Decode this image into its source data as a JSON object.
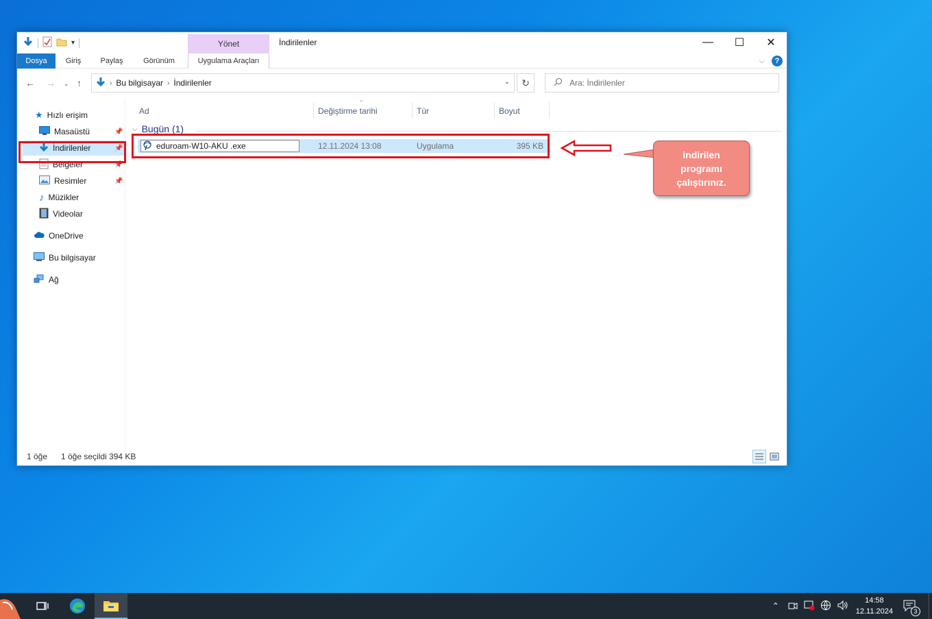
{
  "window": {
    "title": "İndirilenler",
    "context_group": "Yönet",
    "tabs": [
      "Dosya",
      "Giriş",
      "Paylaş",
      "Görünüm",
      "Uygulama Araçları"
    ]
  },
  "address": {
    "crumbs": [
      "Bu bilgisayar",
      "İndirilenler"
    ],
    "search_placeholder": "Ara: İndirilenler"
  },
  "nav": {
    "quick_access": "Hızlı erişim",
    "items": [
      "Masaüstü",
      "İndirilenler",
      "Belgeler",
      "Resimler",
      "Müzikler",
      "Videolar"
    ],
    "onedrive": "OneDrive",
    "this_pc": "Bu bilgisayar",
    "network": "Ağ"
  },
  "columns": [
    "Ad",
    "Değiştirme tarihi",
    "Tür",
    "Boyut"
  ],
  "group_label": "Bugün (1)",
  "file": {
    "name": "eduroam-W10-AKU .exe",
    "date": "12.11.2024 13:08",
    "type": "Uygulama",
    "size": "395 KB"
  },
  "status": {
    "count": "1 öğe",
    "selected": "1 öğe seçildi  394 KB"
  },
  "callout": {
    "line1": "indirilen",
    "line2": "programı",
    "line3": "çalıştırınız."
  },
  "taskbar": {
    "time": "14:58",
    "date": "12.11.2024",
    "notification_count": "3"
  },
  "colors": {
    "accent": "#1979ca",
    "highlight_red": "#e0131d",
    "callout_fill": "#f28b82"
  }
}
